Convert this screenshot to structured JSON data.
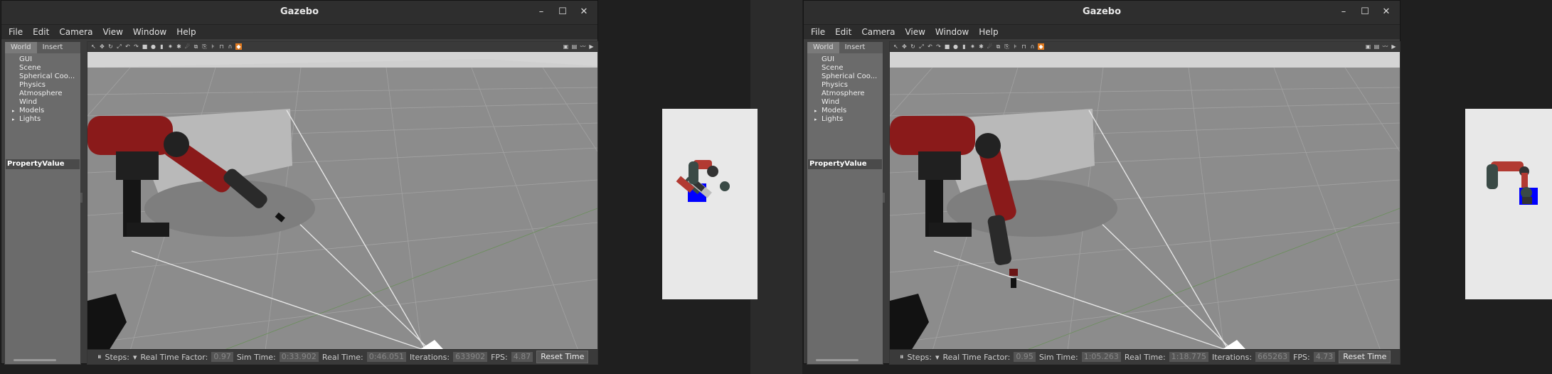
{
  "panels": [
    {
      "window_title": "Gazebo",
      "window_controls": [
        "–",
        "☐",
        "✕"
      ],
      "menu": [
        "File",
        "Edit",
        "Camera",
        "View",
        "Window",
        "Help"
      ],
      "left_tabs": [
        "World",
        "Insert"
      ],
      "tree": [
        {
          "label": "GUI",
          "expandable": false
        },
        {
          "label": "Scene",
          "expandable": false
        },
        {
          "label": "Spherical Coo...",
          "expandable": false
        },
        {
          "label": "Physics",
          "expandable": false
        },
        {
          "label": "Atmosphere",
          "expandable": false
        },
        {
          "label": "Wind",
          "expandable": false
        },
        {
          "label": "Models",
          "expandable": true
        },
        {
          "label": "Lights",
          "expandable": true
        }
      ],
      "property_header": "PropertyValue",
      "status": {
        "pause_icon": "pause-icon",
        "steps_label": "Steps:",
        "rtf_label": "Real Time Factor:",
        "rtf": "0.97",
        "sim_time_label": "Sim Time:",
        "sim_time": "0:33.902",
        "real_time_label": "Real Time:",
        "real_time": "0:46.051",
        "iterations_label": "Iterations:",
        "iterations": "633902",
        "fps_label": "FPS:",
        "fps": "4.87",
        "reset_label": "Reset Time"
      }
    },
    {
      "window_title": "Gazebo",
      "window_controls": [
        "–",
        "☐",
        "✕"
      ],
      "menu": [
        "File",
        "Edit",
        "Camera",
        "View",
        "Window",
        "Help"
      ],
      "left_tabs": [
        "World",
        "Insert"
      ],
      "tree": [
        {
          "label": "GUI",
          "expandable": false
        },
        {
          "label": "Scene",
          "expandable": false
        },
        {
          "label": "Spherical Coo...",
          "expandable": false
        },
        {
          "label": "Physics",
          "expandable": false
        },
        {
          "label": "Atmosphere",
          "expandable": false
        },
        {
          "label": "Wind",
          "expandable": false
        },
        {
          "label": "Models",
          "expandable": true
        },
        {
          "label": "Lights",
          "expandable": true
        }
      ],
      "property_header": "PropertyValue",
      "status": {
        "pause_icon": "pause-icon",
        "steps_label": "Steps:",
        "rtf_label": "Real Time Factor:",
        "rtf": "0.95",
        "sim_time_label": "Sim Time:",
        "sim_time": "1:05.263",
        "real_time_label": "Real Time:",
        "real_time": "1:18.775",
        "iterations_label": "Iterations:",
        "iterations": "665263",
        "fps_label": "FPS:",
        "fps": "4.73",
        "reset_label": "Reset Time"
      }
    }
  ],
  "colors": {
    "robot_red": "#8a1a1a",
    "target_blue": "#0000ff",
    "toolbar_highlight": "#e07a20"
  }
}
